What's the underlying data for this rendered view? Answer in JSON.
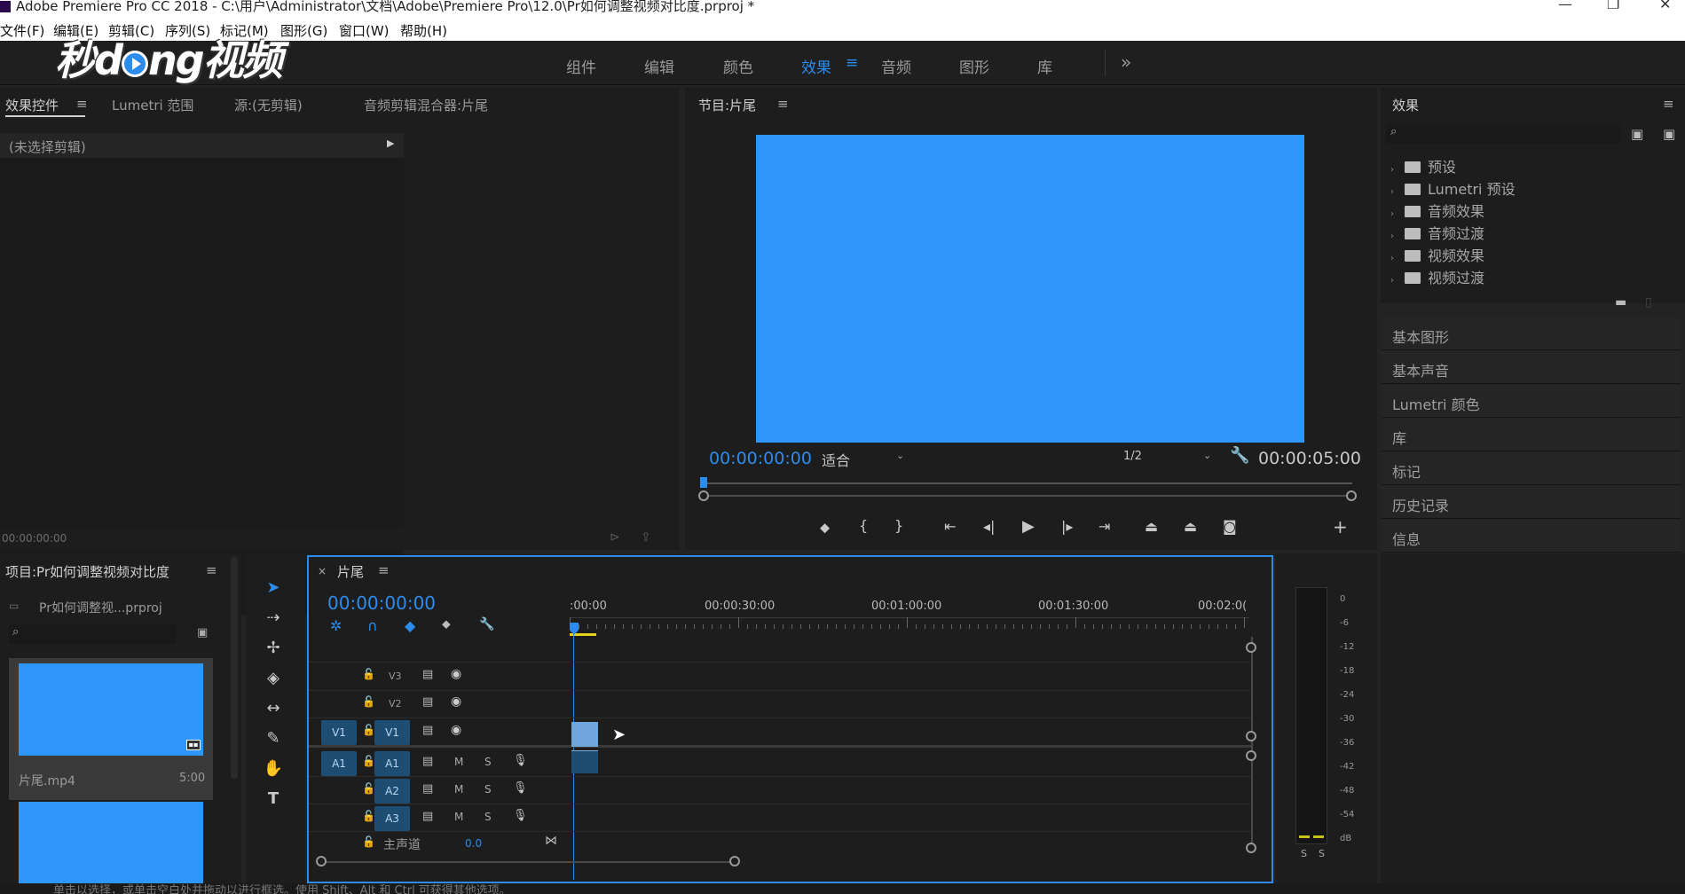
{
  "app": {
    "title": "Adobe Premiere Pro CC 2018 - C:\\用户\\Administrator\\文档\\Adobe\\Premiere Pro\\12.0\\Pr如何调整视频对比度.prproj *"
  },
  "menu": [
    "文件(F)",
    "编辑(E)",
    "剪辑(C)",
    "序列(S)",
    "标记(M)",
    "图形(G)",
    "窗口(W)",
    "帮助(H)"
  ],
  "workspaces": {
    "items": [
      "组件",
      "编辑",
      "颜色",
      "效果",
      "音频",
      "图形",
      "库"
    ],
    "active": "效果",
    "more": "»"
  },
  "watermark": {
    "text_a": "秒",
    "text_b": "d",
    "text_c": "ng视频"
  },
  "effect_controls": {
    "tabs": [
      "效果控件",
      "Lumetri 范围",
      "源:(无剪辑)",
      "音频剪辑混合器:片尾"
    ],
    "no_clip": "(未选择剪辑)",
    "timecode": "00:00:00:00"
  },
  "program_monitor": {
    "title": "节目:片尾",
    "timecode_left": "00:00:00:00",
    "fit": "适合",
    "resolution": "1/2",
    "timecode_right": "00:00:05:00",
    "frame_color": "#2f96fb"
  },
  "effects_panel": {
    "title": "效果",
    "search_placeholder": "",
    "folders": [
      "预设",
      "Lumetri 预设",
      "音频效果",
      "音频过渡",
      "视频效果",
      "视频过渡"
    ]
  },
  "side_sections": [
    "基本图形",
    "基本声音",
    "Lumetri 颜色",
    "库",
    "标记",
    "历史记录",
    "信息"
  ],
  "project": {
    "title": "项目:Pr如何调整视频对比度",
    "file": "Pr如何调整视...prproj",
    "clip_name": "片尾.mp4",
    "clip_duration": "5:00"
  },
  "timeline": {
    "title": "片尾",
    "timecode": "00:00:00:00",
    "ruler": [
      ":00:00",
      "00:00:30:00",
      "00:01:00:00",
      "00:01:30:00",
      "00:02:0("
    ],
    "video_tracks": [
      "V3",
      "V2",
      "V1"
    ],
    "audio_tracks": [
      "A1",
      "A2",
      "A3"
    ],
    "source_v": "V1",
    "source_a": "A1",
    "track_m": "M",
    "track_s": "S",
    "master": "主声道",
    "master_value": "0.0"
  },
  "meter": {
    "scale": [
      "0",
      "-6",
      "-12",
      "-18",
      "-24",
      "-30",
      "-36",
      "-42",
      "-48",
      "-54",
      "dB"
    ],
    "solo": [
      "S",
      "S"
    ]
  },
  "status": {
    "text": "单击以选择，或单击空白处并拖动以进行框选。使用 Shift、Alt 和 Ctrl 可获得其他选项。"
  },
  "colors": {
    "accent": "#2d8ceb",
    "clip": "#2f96fb",
    "track_btn": "#1e4d74",
    "playhead_bar": "#e6d21a"
  }
}
